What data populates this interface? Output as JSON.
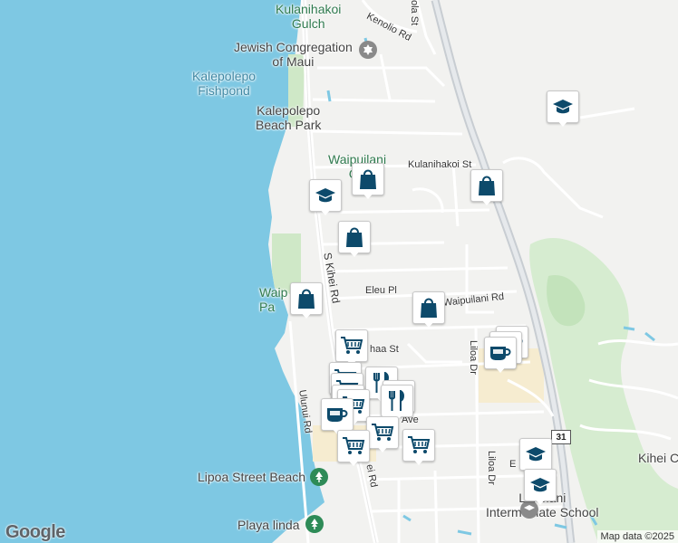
{
  "map": {
    "places": {
      "kulanihakoi_gulch": "Kulanihakoi\nGulch",
      "jewish_congregation": "Jewish Congregation\nof Maui",
      "kalepolepo_fishpond": "Kalepolepo\nFishpond",
      "kalepolepo_beach_park": "Kalepolepo\nBeach Park",
      "waipuilani_gulch": "Waipuilani\nGu",
      "waipuilani_park": "Waip\nPa",
      "lipoa_street_beach": "Lipoa Street Beach",
      "playa_linda": "Playa linda",
      "lokelani_school": "Lokelani\nIntermediate School",
      "kihei_c": "Kihei C"
    },
    "streets": {
      "kenolio_rd": "Kenolio Rd",
      "ola_st": "ola St",
      "kulanihakoi_st": "Kulanihakoi St",
      "s_kihei_rd": "S Kihei Rd",
      "eleu_pl": "Eleu Pl",
      "e_waipuilani_rd": "E Waipuilani Rd",
      "haa_st": "haa St",
      "liloa_dr_upper": "Liloa Dr",
      "liloa_dr_lower": "Liloa Dr",
      "ulunui_rd": "Ulunui Rd",
      "kihei_rd_lower": "ei Rd",
      "ave": "Ave",
      "e_l": "E L",
      "route_31": "31"
    },
    "icons": {
      "school": "graduation-cap-icon",
      "shopping": "shopping-bag-icon",
      "grocery": "shopping-cart-icon",
      "restaurant": "fork-knife-icon",
      "cafe": "coffee-cup-icon",
      "synagogue": "star-of-david-icon",
      "beach": "beach-icon"
    },
    "colors": {
      "water": "#7ec8e3",
      "land": "#f2f2f0",
      "park": "#cfe8c7",
      "highway": "#c8cdd2",
      "marker": "#0d4a6b",
      "commercial": "#f6ecd0"
    },
    "logo": "Google",
    "attribution": "Map data ©2025"
  }
}
